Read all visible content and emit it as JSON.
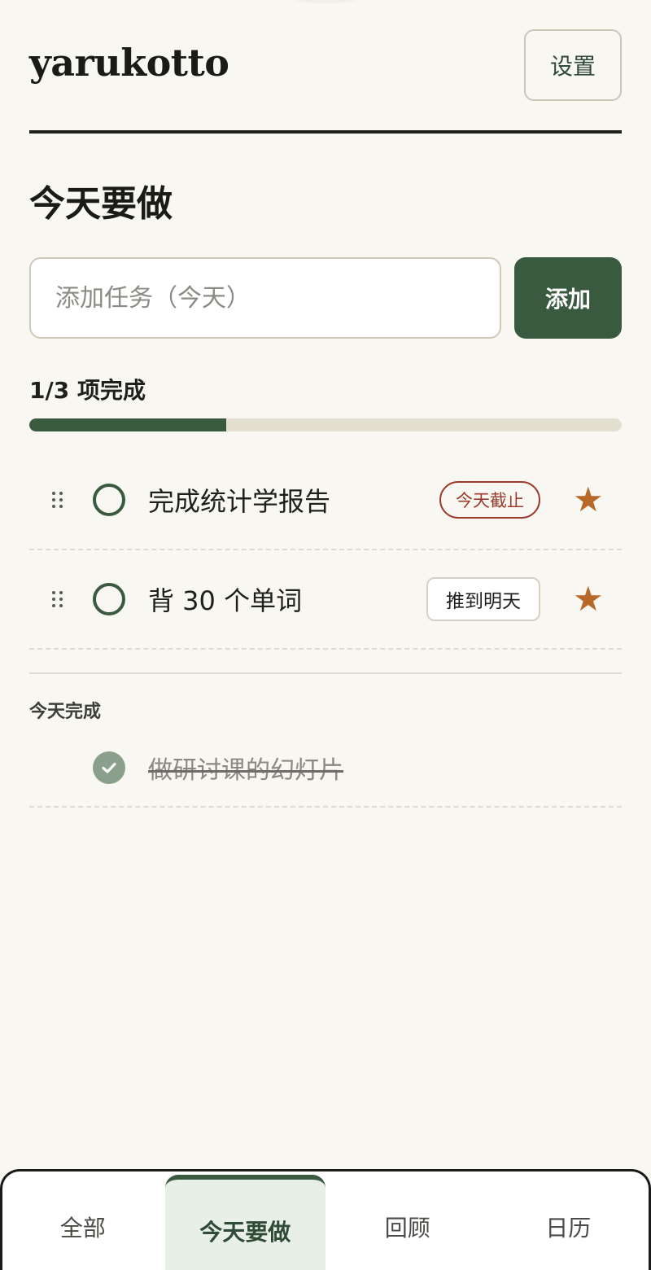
{
  "header": {
    "app_title": "yarukotto",
    "settings_label": "设置"
  },
  "page": {
    "title": "今天要做"
  },
  "add_task": {
    "placeholder": "添加任务（今天）",
    "value": "",
    "button_label": "添加"
  },
  "progress": {
    "label": "1/3 项完成",
    "completed": 1,
    "total": 3,
    "fraction": 0.333
  },
  "tasks": [
    {
      "text": "完成统计学报告",
      "badge": "今天截止",
      "starred": true
    },
    {
      "text": "背 30 个单词",
      "action_label": "推到明天",
      "starred": true
    }
  ],
  "icons": {
    "star": "★"
  },
  "done_section": {
    "heading": "今天完成",
    "items": [
      {
        "text": "做研讨课的幻灯片"
      }
    ]
  },
  "nav": {
    "tabs": [
      {
        "label": "全部"
      },
      {
        "label": "今天要做",
        "active": true
      },
      {
        "label": "回顾"
      },
      {
        "label": "日历"
      }
    ]
  },
  "colors": {
    "background": "#f9f7f2",
    "accent": "#3a5a40",
    "deadline": "#9c3b2c",
    "star": "#b8692a"
  }
}
